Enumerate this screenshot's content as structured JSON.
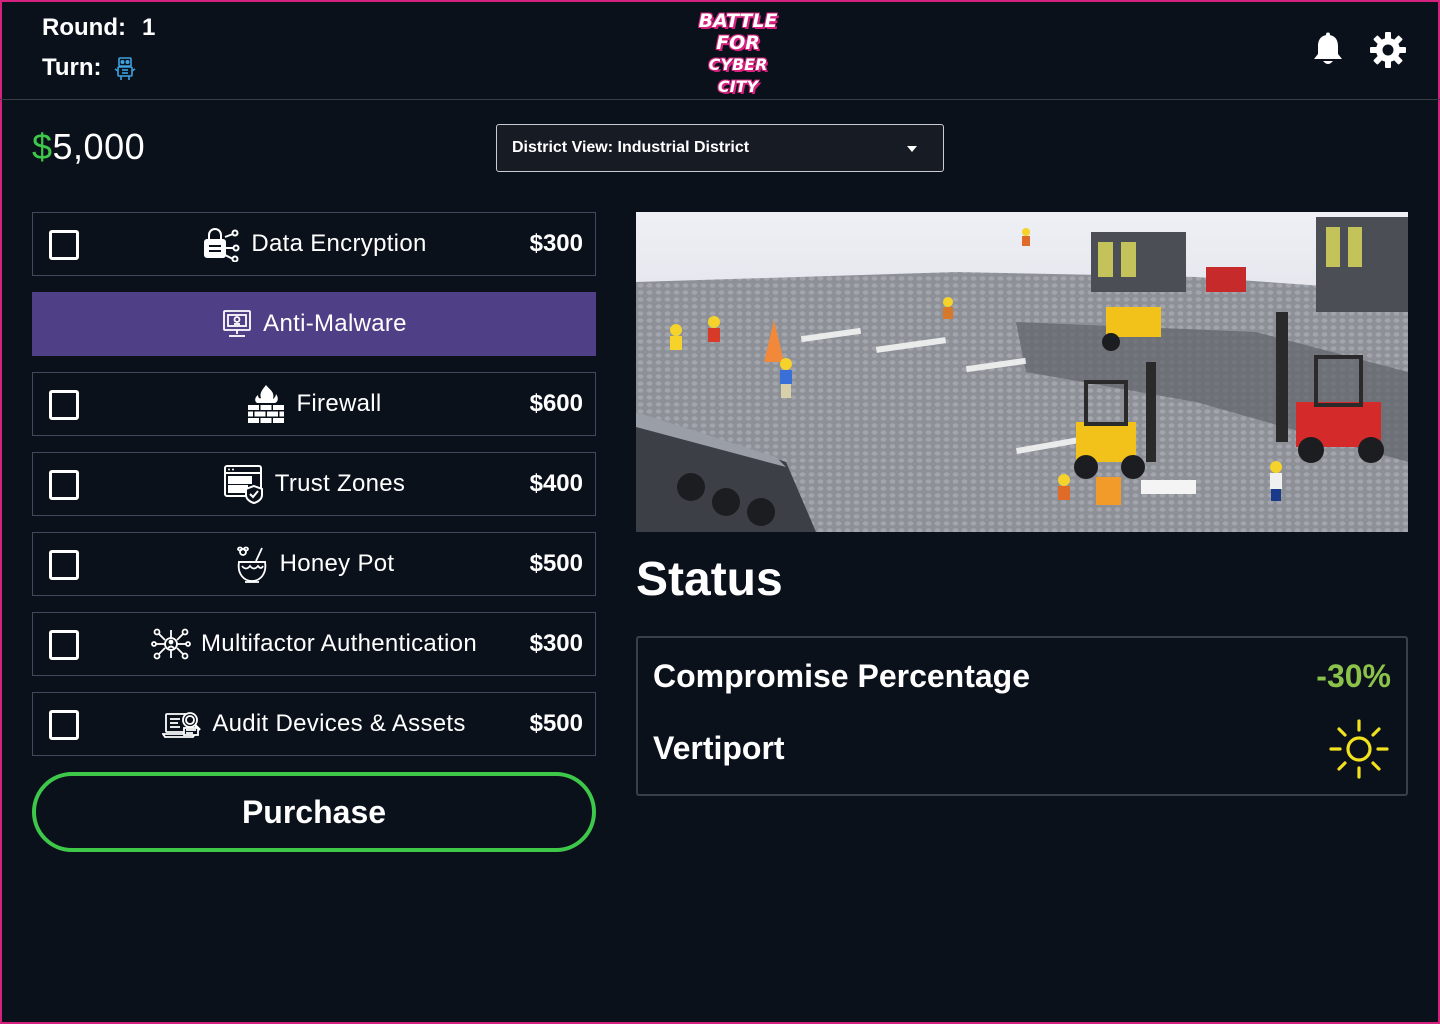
{
  "header": {
    "round_label": "Round:",
    "round_value": "1",
    "turn_label": "Turn:",
    "turn_icon": "robot-icon",
    "logo_lines": [
      "BATTLE",
      "FOR",
      "CYBER CITY"
    ],
    "notification_icon": "bell-icon",
    "settings_icon": "gear-icon"
  },
  "budget": {
    "currency": "$",
    "amount": "5,000"
  },
  "district_select": {
    "value": "District View: Industrial District"
  },
  "items": [
    {
      "name": "Data Encryption",
      "price": "$300",
      "icon": "encryption-lock-icon",
      "selected": false
    },
    {
      "name": "Anti-Malware",
      "price": "",
      "icon": "anti-malware-monitor-icon",
      "selected": true
    },
    {
      "name": "Firewall",
      "price": "$600",
      "icon": "firewall-icon",
      "selected": false
    },
    {
      "name": "Trust Zones",
      "price": "$400",
      "icon": "trust-zones-icon",
      "selected": false
    },
    {
      "name": "Honey Pot",
      "price": "$500",
      "icon": "honey-pot-icon",
      "selected": false
    },
    {
      "name": "Multifactor Authentication",
      "price": "$300",
      "icon": "mfa-network-icon",
      "selected": false
    },
    {
      "name": "Audit Devices & Assets",
      "price": "$500",
      "icon": "audit-devices-icon",
      "selected": false
    }
  ],
  "purchase_label": "Purchase",
  "status": {
    "title": "Status",
    "compromise_label": "Compromise Percentage",
    "compromise_value": "-30%",
    "vertiport_label": "Vertiport",
    "vertiport_icon": "sun-icon"
  },
  "colors": {
    "background": "#0b111b",
    "accent_green": "#3ec84a",
    "selected_purple": "#4f3f86",
    "frame_pink": "#d4227e",
    "status_green": "#8bc34a",
    "sun_yellow": "#f2e21d"
  }
}
